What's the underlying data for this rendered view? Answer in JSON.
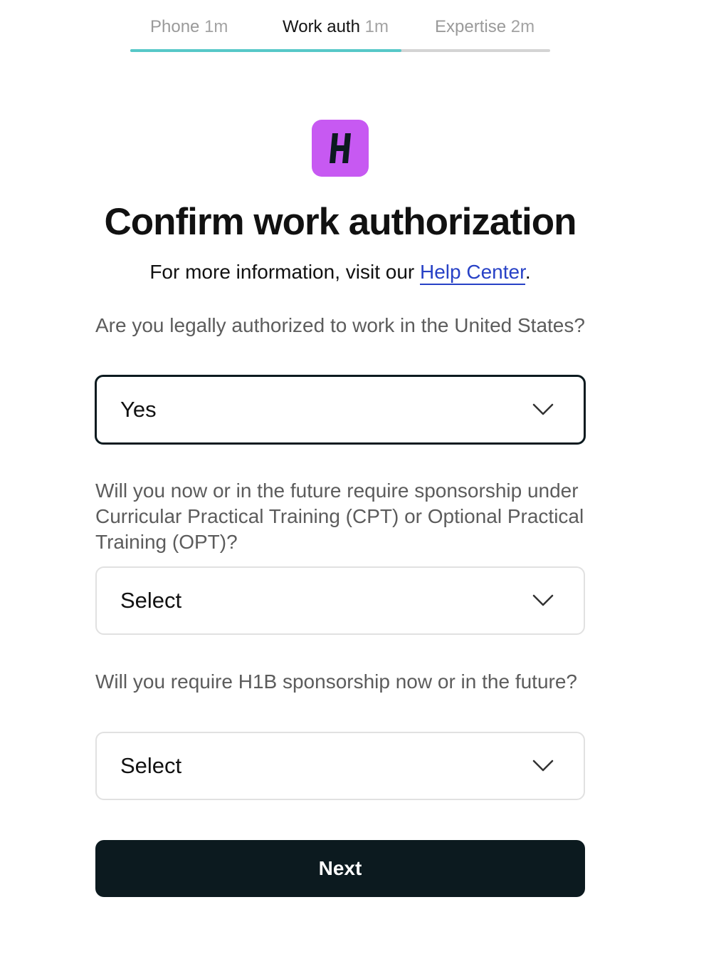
{
  "steps": [
    {
      "name": "Phone",
      "time": "1m",
      "active": false
    },
    {
      "name": "Work auth",
      "time": "1m",
      "active": true
    },
    {
      "name": "Expertise",
      "time": "2m",
      "active": false
    }
  ],
  "progress": 0.645,
  "colors": {
    "accent_track": "#57c8c8",
    "logo_bg": "#c759f2",
    "link": "#2741c6",
    "primary_button": "#0c1a1f"
  },
  "logo": {
    "icon": "h-logo-icon",
    "letter": "H"
  },
  "heading": {
    "title": "Confirm work authorization",
    "subtitle_prefix": "For more information, visit our ",
    "help_link": "Help Center",
    "subtitle_suffix": "."
  },
  "form": {
    "q1": {
      "label": "Are you legally authorized to work in the United States?",
      "value": "Yes"
    },
    "q2": {
      "label": "Will you now or in the future require sponsorship under Curricular Practical Training (CPT) or Optional Practical Training (OPT)?",
      "value": "Select"
    },
    "q3": {
      "label": "Will you require H1B sponsorship now or in the future?",
      "value": "Select"
    }
  },
  "next_label": "Next"
}
